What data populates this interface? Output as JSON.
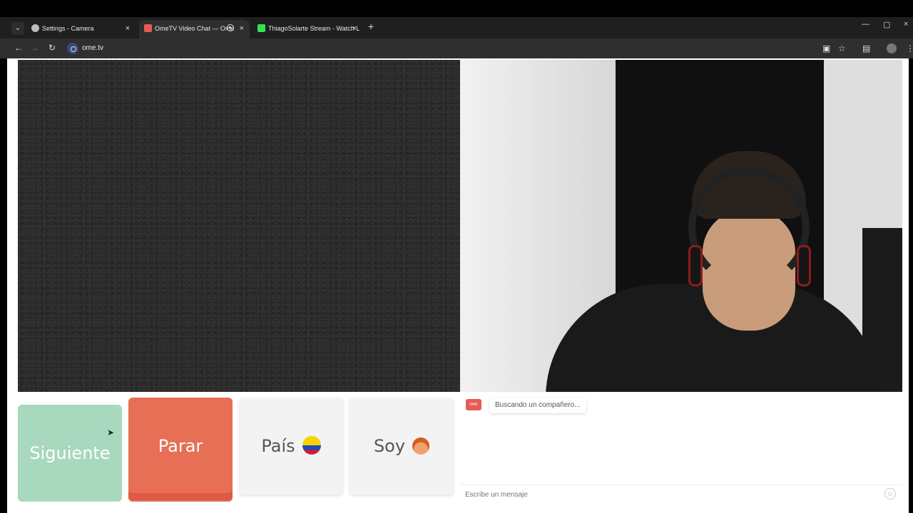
{
  "browser": {
    "tabs": [
      {
        "title": "Settings - Camera",
        "icon": "gear-icon"
      },
      {
        "title": "OmeTV Video Chat — Ome",
        "icon": "ometv-icon",
        "active": true
      },
      {
        "title": "ThiagoSolarte Stream - Watch L",
        "icon": "kick-icon"
      }
    ],
    "url": "ome.tv",
    "controls": {
      "back": "←",
      "forward": "→",
      "reload": "↻",
      "new_tab": "+",
      "minimize": "—",
      "maximize": "▢",
      "close": "×"
    }
  },
  "buttons": {
    "next": "Siguiente",
    "stop": "Parar",
    "country": "País",
    "gender": "Soy"
  },
  "chat": {
    "logo_text": "Ome\nTV",
    "status": "Buscando un compañero...",
    "placeholder": "Escribe un mensaje"
  },
  "icons": {
    "country_flag": "colombia-flag-icon",
    "gender_avatar": "boy-emoji-icon",
    "emoji": "smile-icon"
  }
}
